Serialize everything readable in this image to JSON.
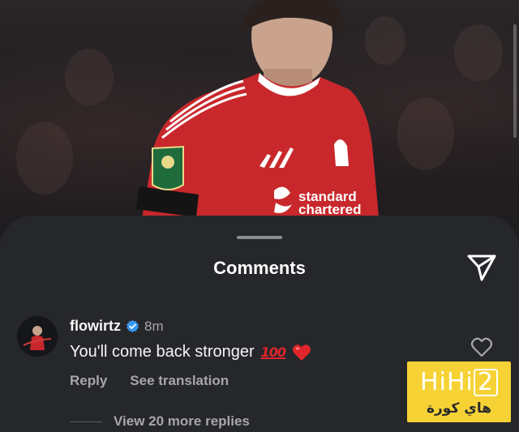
{
  "sheet": {
    "title": "Comments"
  },
  "comment": {
    "username": "flowirtz",
    "verified": true,
    "time": "8m",
    "text": "You'll come back stronger",
    "emoji_100": "100",
    "reply_label": "Reply",
    "translate_label": "See translation",
    "more_replies_label": "View 20 more replies"
  },
  "icons": {
    "share": "paper-plane-icon",
    "like": "heart-outline-icon",
    "verified": "verified-badge-icon"
  },
  "jersey": {
    "sponsor_line1": "standard",
    "sponsor_line2": "chartered"
  },
  "watermark": {
    "logo_prefix": "HiHi",
    "logo_number": "2",
    "subtitle": "هاي كورة"
  },
  "colors": {
    "sheet_bg": "#26272b",
    "verified_blue": "#3797f0",
    "heart_red": "#e0262b",
    "watermark_yellow": "#f6d235",
    "jersey_red": "#c8282c"
  }
}
